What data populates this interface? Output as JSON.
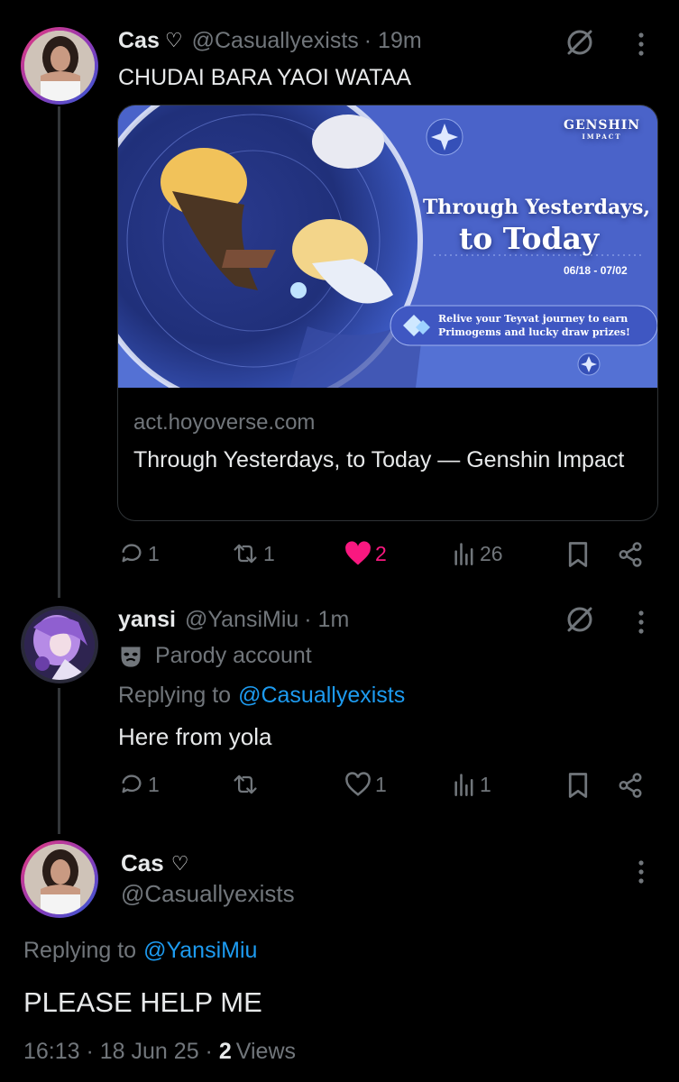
{
  "tweet1": {
    "name": "Cas",
    "heart_glyph": "♡",
    "handle": "@Casuallyexists",
    "time": "· 19m",
    "text": "CHUDAI BARA YAOI WATAA",
    "card": {
      "brand_main": "GENSHIN",
      "brand_sub": "IMPACT",
      "headline_1": "Through Yesterdays,",
      "headline_2": "to Today",
      "dates": "06/18 - 07/02",
      "promo_1": "Relive your Teyvat journey to earn",
      "promo_2": "Primogems and lucky draw prizes!",
      "domain": "act.hoyoverse.com",
      "title": "Through Yesterdays, to Today — Genshin Impact"
    },
    "stats": {
      "replies": "1",
      "reposts": "1",
      "likes": "2",
      "views": "26"
    }
  },
  "tweet2": {
    "name": "yansi",
    "handle": "@YansiMiu",
    "time": "· 1m",
    "label": "Parody account",
    "replying_prefix": "Replying to",
    "replying_to": "@Casuallyexists",
    "text": "Here from yola",
    "stats": {
      "replies": "1",
      "reposts": "",
      "likes": "1",
      "views": "1"
    }
  },
  "tweet3": {
    "name": "Cas",
    "heart_glyph": "♡",
    "handle": "@Casuallyexists",
    "replying_prefix": "Replying to",
    "replying_to": "@YansiMiu",
    "text": "PLEASE HELP ME",
    "timestamp": "16:13 · 18 Jun 25 ·",
    "views_count": "2",
    "views_label": "Views"
  },
  "colors": {
    "like_active": "#f91880",
    "link": "#1d9bf0",
    "muted": "#71767b"
  }
}
